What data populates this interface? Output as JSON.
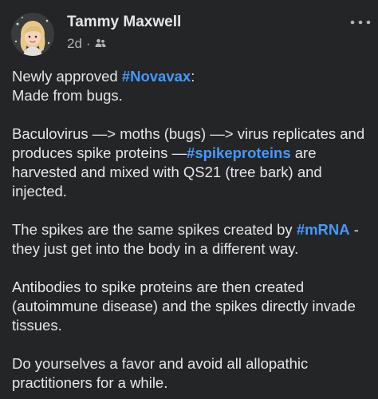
{
  "author": {
    "name": "Tammy Maxwell",
    "time": "2d",
    "separator": "·",
    "audience_icon": "friends-icon"
  },
  "post": {
    "p1": {
      "l1_pre": "Newly approved ",
      "l1_tag": "#Novavax",
      "l1_post": ":",
      "l2": "Made from bugs."
    },
    "p2": {
      "l1": "Baculovirus —> moths (bugs) —> virus replicates and",
      "l2_pre": "produces spike proteins —",
      "l2_tag": "#spikeproteins",
      "l2_post": " are",
      "l3": "harvested and mixed with QS21 (tree bark) and",
      "l4": "injected."
    },
    "p3": {
      "l1_pre": "The spikes are the same spikes created by ",
      "l1_tag": "#mRNA",
      "l1_post": " -",
      "l2": "they just get into the body in a different way."
    },
    "p4": {
      "l1": "Antibodies to spike proteins are then created",
      "l2": "(autoimmune disease) and the spikes directly invade",
      "l3": "tissues."
    },
    "p5": {
      "l1": "Do yourselves a favor and avoid all allopathic",
      "l2": "practitioners for a while."
    }
  },
  "colors": {
    "background": "#242526",
    "text": "#e4e6eb",
    "secondary_text": "#b0b3b8",
    "hashtag": "#4599ff"
  }
}
